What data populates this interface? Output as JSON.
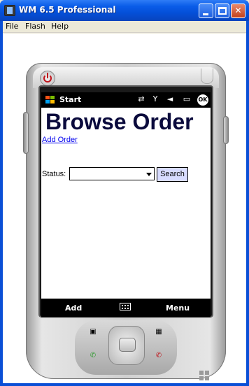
{
  "window": {
    "title": "WM 6.5 Professional"
  },
  "menubar": {
    "items": [
      "File",
      "Flash",
      "Help"
    ]
  },
  "phone": {
    "topbar": {
      "start_label": "Start",
      "ok_label": "OK"
    },
    "page": {
      "heading": "Browse Order",
      "add_link": "Add Order",
      "status_label": "Status:",
      "status_value": "",
      "search_label": "Search"
    },
    "softkeys": {
      "left": "Add",
      "right": "Menu"
    }
  },
  "colors": {
    "titlebar": "#0450d9",
    "heading": "#0a0a3c",
    "link": "#0000ee",
    "search_button": "#d8dcff"
  }
}
